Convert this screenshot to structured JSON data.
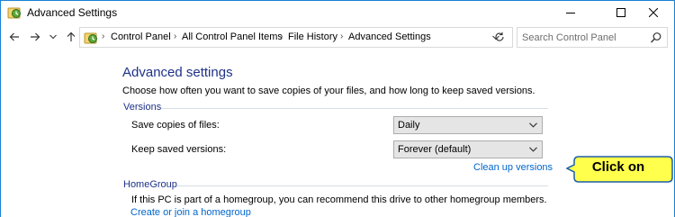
{
  "window": {
    "title": "Advanced Settings"
  },
  "address_bar": {
    "crumbs": [
      "Control Panel",
      "All Control Panel Items",
      "File History",
      "Advanced Settings"
    ]
  },
  "search": {
    "placeholder": "Search Control Panel"
  },
  "main": {
    "heading": "Advanced settings",
    "description": "Choose how often you want to save copies of your files, and how long to keep saved versions.",
    "versions": {
      "group_label": "Versions",
      "save_copies_label": "Save copies of files:",
      "save_copies_value": "Daily",
      "keep_versions_label": "Keep saved versions:",
      "keep_versions_value": "Forever (default)",
      "cleanup_link": "Clean up versions"
    },
    "homegroup": {
      "group_label": "HomeGroup",
      "text": "If this PC is part of a homegroup, you can recommend this drive to other homegroup members.",
      "link": "Create or join a homegroup"
    }
  },
  "callout": {
    "text": "Click on",
    "fill_color": "#ffff4c",
    "border_color": "#1f5fa8"
  },
  "colors": {
    "heading": "#1e3287",
    "link": "#0066cc",
    "window_border": "#1883d7"
  }
}
